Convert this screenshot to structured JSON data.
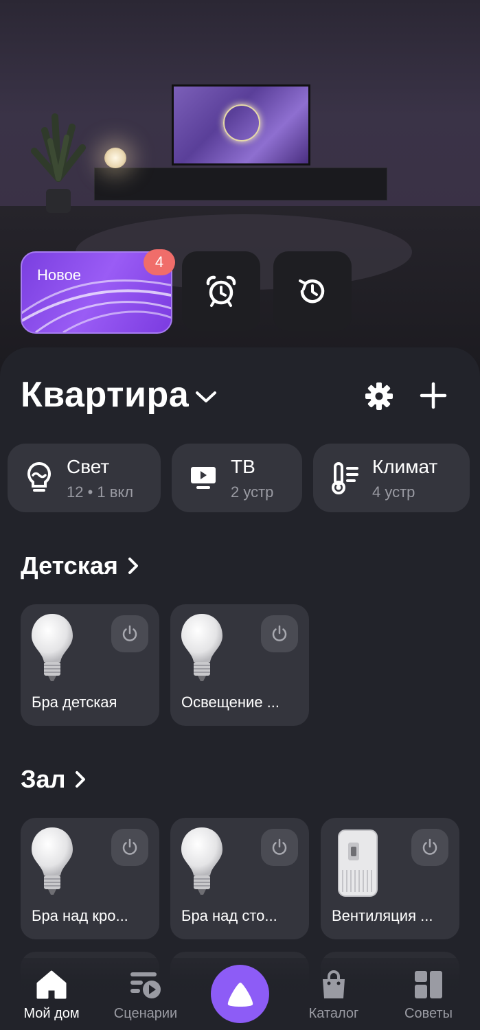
{
  "quick_actions": {
    "new_label": "Новое",
    "new_badge": "4",
    "alarm_icon": "alarm-clock-icon",
    "history_icon": "history-icon"
  },
  "header": {
    "home_name": "Квартира"
  },
  "categories": [
    {
      "name": "Свет",
      "sub": "12 • 1 вкл",
      "icon": "bulb-icon"
    },
    {
      "name": "ТВ",
      "sub": "2 устр",
      "icon": "tv-icon"
    },
    {
      "name": "Климат",
      "sub": "4 устр",
      "icon": "thermometer-icon"
    }
  ],
  "rooms": [
    {
      "name": "Детская",
      "devices": [
        {
          "name": "Бра детская"
        },
        {
          "name": "Освещение ..."
        }
      ]
    },
    {
      "name": "Зал",
      "devices": [
        {
          "name": "Бра над кро..."
        },
        {
          "name": "Бра над сто..."
        },
        {
          "name": "Вентиляция ..."
        }
      ]
    }
  ],
  "nav": {
    "home": "Мой дом",
    "scenarios": "Сценарии",
    "catalog": "Каталог",
    "tips": "Советы"
  },
  "colors": {
    "accent": "#8d5cf6",
    "badge": "#f06d6a",
    "panel": "#22232a",
    "card": "#34353d"
  }
}
